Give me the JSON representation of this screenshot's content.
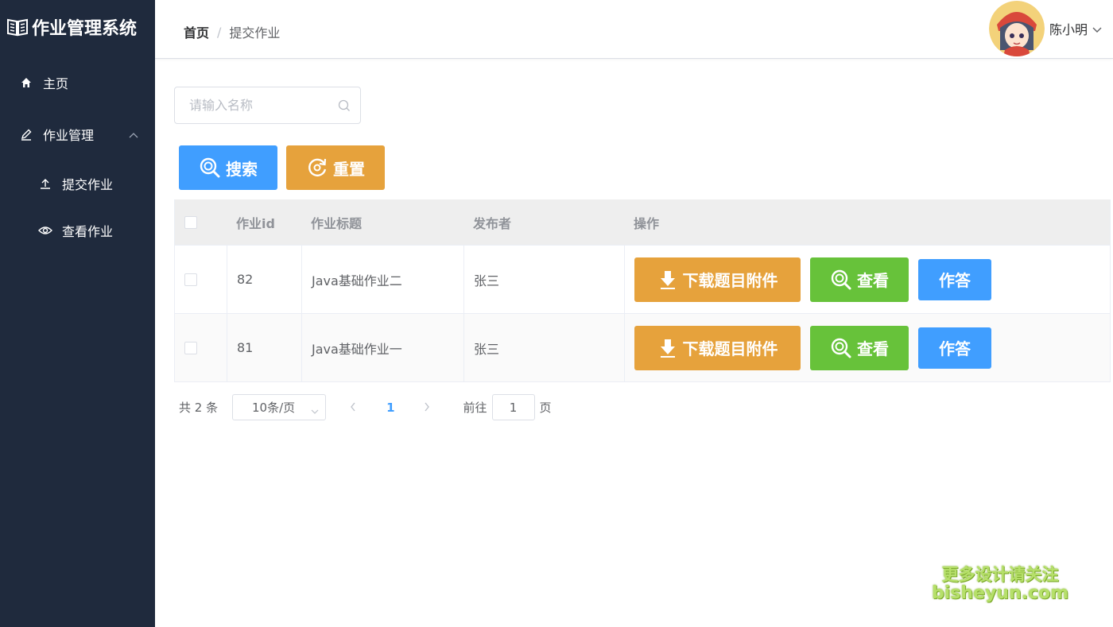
{
  "app": {
    "title": "作业管理系统"
  },
  "sidebar": {
    "items": [
      {
        "label": "主页",
        "icon": "home-icon"
      },
      {
        "label": "作业管理",
        "icon": "edit-icon"
      },
      {
        "label": "提交作业",
        "icon": "upload-icon"
      },
      {
        "label": "查看作业",
        "icon": "eye-icon"
      }
    ]
  },
  "header": {
    "breadcrumb": {
      "home": "首页",
      "separator": "/",
      "current": "提交作业"
    },
    "user": {
      "name": "陈小明"
    }
  },
  "search": {
    "placeholder": "请输入名称",
    "value": ""
  },
  "toolbar": {
    "search_label": "搜索",
    "reset_label": "重置"
  },
  "table": {
    "columns": [
      "作业id",
      "作业标题",
      "发布者",
      "操作"
    ],
    "rows": [
      {
        "id": "82",
        "title": "Java基础作业二",
        "publisher": "张三"
      },
      {
        "id": "81",
        "title": "Java基础作业一",
        "publisher": "张三"
      }
    ],
    "actions": {
      "download": "下载题目附件",
      "view": "查看",
      "answer": "作答"
    }
  },
  "pagination": {
    "total": "共 2 条",
    "page_size": "10条/页",
    "current_page": "1",
    "goto_prefix": "前往",
    "goto_value": "1",
    "goto_suffix": "页"
  },
  "watermark": {
    "line1": "更多设计请关注",
    "line2": "bisheyun.com"
  },
  "colors": {
    "sidebar_bg": "#1f2a3d",
    "primary": "#409eff",
    "warning": "#e6a23c",
    "success": "#67c23a"
  }
}
